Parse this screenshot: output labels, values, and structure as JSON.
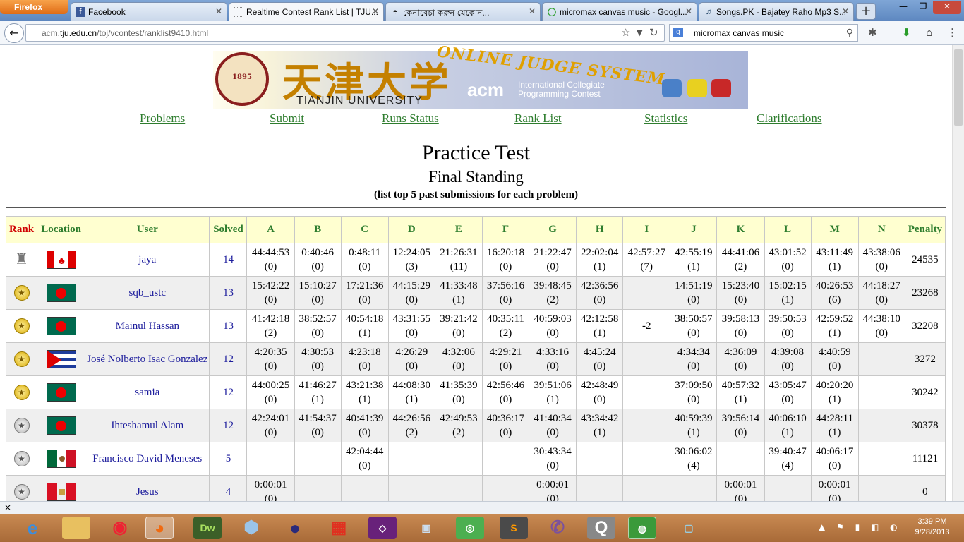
{
  "browser": {
    "app_button": "Firefox",
    "tabs": [
      {
        "title": "Facebook",
        "icon": "facebook-icon",
        "active": false
      },
      {
        "title": "Realtime Contest Rank List | TJU...",
        "icon": "page-icon",
        "active": true
      },
      {
        "title": "কেনাবেচা করুন যেকোন...",
        "icon": "bikroy-icon",
        "active": false
      },
      {
        "title": "micromax canvas music - Googl...",
        "icon": "google-icon",
        "active": false
      },
      {
        "title": "Songs.PK - Bajatey Raho Mp3 S...",
        "icon": "music-icon",
        "active": false
      }
    ],
    "url_prefix": "acm.",
    "url_domain": "tju.edu.cn",
    "url_path": "/toj/vcontest/ranklist9410.html",
    "search_query": "micromax canvas music",
    "status_close": "×"
  },
  "menu": [
    "Problems",
    "Submit",
    "Runs Status",
    "Rank List",
    "Statistics",
    "Clarifications"
  ],
  "banner": {
    "seal_text": "1895",
    "calligraphy": "天津大学",
    "university": "TIANJIN  UNIVERSITY",
    "oj_text": "ONLINE JUDGE SYSTEM",
    "acm": "acm",
    "acm_line1": "International Collegiate",
    "acm_line2": "Programming Contest"
  },
  "contest": {
    "title": "Practice Test",
    "status": "Final Standing",
    "note": "(list top 5 past submissions for each problem)"
  },
  "table": {
    "headers": [
      "Rank",
      "Location",
      "User",
      "Solved",
      "A",
      "B",
      "C",
      "D",
      "E",
      "F",
      "G",
      "H",
      "I",
      "J",
      "K",
      "L",
      "M",
      "N",
      "Penalty"
    ],
    "rows": [
      {
        "medal": "trophy",
        "flag": "canada",
        "user": "jaya",
        "solved": "14",
        "cells": [
          [
            "44:44:53",
            "(0)"
          ],
          [
            "0:40:46",
            "(0)"
          ],
          [
            "0:48:11",
            "(0)"
          ],
          [
            "12:24:05",
            "(3)"
          ],
          [
            "21:26:31",
            "(11)"
          ],
          [
            "16:20:18",
            "(0)"
          ],
          [
            "21:22:47",
            "(0)"
          ],
          [
            "22:02:04",
            "(1)"
          ],
          [
            "42:57:27",
            "(7)"
          ],
          [
            "42:55:19",
            "(1)"
          ],
          [
            "44:41:06",
            "(2)"
          ],
          [
            "43:01:52",
            "(0)"
          ],
          [
            "43:11:49",
            "(1)"
          ],
          [
            "43:38:06",
            "(0)"
          ]
        ],
        "penalty": "24535"
      },
      {
        "medal": "gold",
        "flag": "bangladesh",
        "user": "sqb_ustc",
        "solved": "13",
        "cells": [
          [
            "15:42:22",
            "(0)"
          ],
          [
            "15:10:27",
            "(0)"
          ],
          [
            "17:21:36",
            "(0)"
          ],
          [
            "44:15:29",
            "(0)"
          ],
          [
            "41:33:48",
            "(1)"
          ],
          [
            "37:56:16",
            "(0)"
          ],
          [
            "39:48:45",
            "(2)"
          ],
          [
            "42:36:56",
            "(0)"
          ],
          [
            "",
            ""
          ],
          [
            "14:51:19",
            "(0)"
          ],
          [
            "15:23:40",
            "(0)"
          ],
          [
            "15:02:15",
            "(1)"
          ],
          [
            "40:26:53",
            "(6)"
          ],
          [
            "44:18:27",
            "(0)"
          ]
        ],
        "penalty": "23268"
      },
      {
        "medal": "gold",
        "flag": "bangladesh",
        "user": "Mainul Hassan",
        "solved": "13",
        "cells": [
          [
            "41:42:18",
            "(2)"
          ],
          [
            "38:52:57",
            "(0)"
          ],
          [
            "40:54:18",
            "(1)"
          ],
          [
            "43:31:55",
            "(0)"
          ],
          [
            "39:21:42",
            "(0)"
          ],
          [
            "40:35:11",
            "(2)"
          ],
          [
            "40:59:03",
            "(0)"
          ],
          [
            "42:12:58",
            "(1)"
          ],
          [
            "-2",
            ""
          ],
          [
            "38:50:57",
            "(0)"
          ],
          [
            "39:58:13",
            "(0)"
          ],
          [
            "39:50:53",
            "(0)"
          ],
          [
            "42:59:52",
            "(1)"
          ],
          [
            "44:38:10",
            "(0)"
          ]
        ],
        "penalty": "32208"
      },
      {
        "medal": "gold",
        "flag": "cuba",
        "user": "José Nolberto Isac Gonzalez",
        "solved": "12",
        "cells": [
          [
            "4:20:35",
            "(0)"
          ],
          [
            "4:30:53",
            "(0)"
          ],
          [
            "4:23:18",
            "(0)"
          ],
          [
            "4:26:29",
            "(0)"
          ],
          [
            "4:32:06",
            "(0)"
          ],
          [
            "4:29:21",
            "(0)"
          ],
          [
            "4:33:16",
            "(0)"
          ],
          [
            "4:45:24",
            "(0)"
          ],
          [
            "",
            ""
          ],
          [
            "4:34:34",
            "(0)"
          ],
          [
            "4:36:09",
            "(0)"
          ],
          [
            "4:39:08",
            "(0)"
          ],
          [
            "4:40:59",
            "(0)"
          ],
          [
            "",
            ""
          ]
        ],
        "penalty": "3272"
      },
      {
        "medal": "gold",
        "flag": "bangladesh",
        "user": "samia",
        "solved": "12",
        "cells": [
          [
            "44:00:25",
            "(0)"
          ],
          [
            "41:46:27",
            "(1)"
          ],
          [
            "43:21:38",
            "(1)"
          ],
          [
            "44:08:30",
            "(1)"
          ],
          [
            "41:35:39",
            "(0)"
          ],
          [
            "42:56:46",
            "(0)"
          ],
          [
            "39:51:06",
            "(1)"
          ],
          [
            "42:48:49",
            "(0)"
          ],
          [
            "",
            ""
          ],
          [
            "37:09:50",
            "(0)"
          ],
          [
            "40:57:32",
            "(1)"
          ],
          [
            "43:05:47",
            "(0)"
          ],
          [
            "40:20:20",
            "(1)"
          ],
          [
            "",
            ""
          ]
        ],
        "penalty": "30242"
      },
      {
        "medal": "silver",
        "flag": "bangladesh",
        "user": "Ihteshamul Alam",
        "solved": "12",
        "cells": [
          [
            "42:24:01",
            "(0)"
          ],
          [
            "41:54:37",
            "(0)"
          ],
          [
            "40:41:39",
            "(0)"
          ],
          [
            "44:26:56",
            "(2)"
          ],
          [
            "42:49:53",
            "(2)"
          ],
          [
            "40:36:17",
            "(0)"
          ],
          [
            "41:40:34",
            "(0)"
          ],
          [
            "43:34:42",
            "(1)"
          ],
          [
            "",
            ""
          ],
          [
            "40:59:39",
            "(1)"
          ],
          [
            "39:56:14",
            "(0)"
          ],
          [
            "40:06:10",
            "(1)"
          ],
          [
            "44:28:11",
            "(1)"
          ],
          [
            "",
            ""
          ]
        ],
        "penalty": "30378"
      },
      {
        "medal": "silver",
        "flag": "mexico",
        "user": "Francisco David Meneses",
        "solved": "5",
        "cells": [
          [
            "",
            ""
          ],
          [
            "",
            ""
          ],
          [
            "42:04:44",
            "(0)"
          ],
          [
            "",
            ""
          ],
          [
            "",
            ""
          ],
          [
            "",
            ""
          ],
          [
            "30:43:34",
            "(0)"
          ],
          [
            "",
            ""
          ],
          [
            "",
            ""
          ],
          [
            "30:06:02",
            "(4)"
          ],
          [
            "",
            ""
          ],
          [
            "39:40:47",
            "(4)"
          ],
          [
            "40:06:17",
            "(0)"
          ],
          [
            "",
            ""
          ]
        ],
        "penalty": "11121"
      },
      {
        "medal": "silver",
        "flag": "peru",
        "user": "Jesus",
        "solved": "4",
        "cells": [
          [
            "0:00:01",
            "(0)"
          ],
          [
            "",
            ""
          ],
          [
            "",
            ""
          ],
          [
            "",
            ""
          ],
          [
            "",
            ""
          ],
          [
            "",
            ""
          ],
          [
            "0:00:01",
            "(0)"
          ],
          [
            "",
            ""
          ],
          [
            "",
            ""
          ],
          [
            "",
            ""
          ],
          [
            "0:00:01",
            "(0)"
          ],
          [
            "",
            ""
          ],
          [
            "0:00:01",
            "(0)"
          ],
          [
            "",
            ""
          ]
        ],
        "penalty": "0"
      }
    ]
  },
  "taskbar": {
    "apps": [
      "ie",
      "explorer",
      "chrome",
      "firefox",
      "Dw",
      "virtualbox",
      "eclipse",
      "office",
      "visualstudio",
      "remote",
      "odnoklassniki",
      "sublime",
      "viber",
      "Q",
      "network",
      "rdp"
    ],
    "time": "3:39 PM",
    "date": "9/28/2013"
  },
  "colors": {
    "menu_link": "#2e7d2e",
    "header_bg": "#ffffd0",
    "rank_header": "#d00000",
    "user_link": "#1c1c9c",
    "taskbar": "#b87a45"
  }
}
